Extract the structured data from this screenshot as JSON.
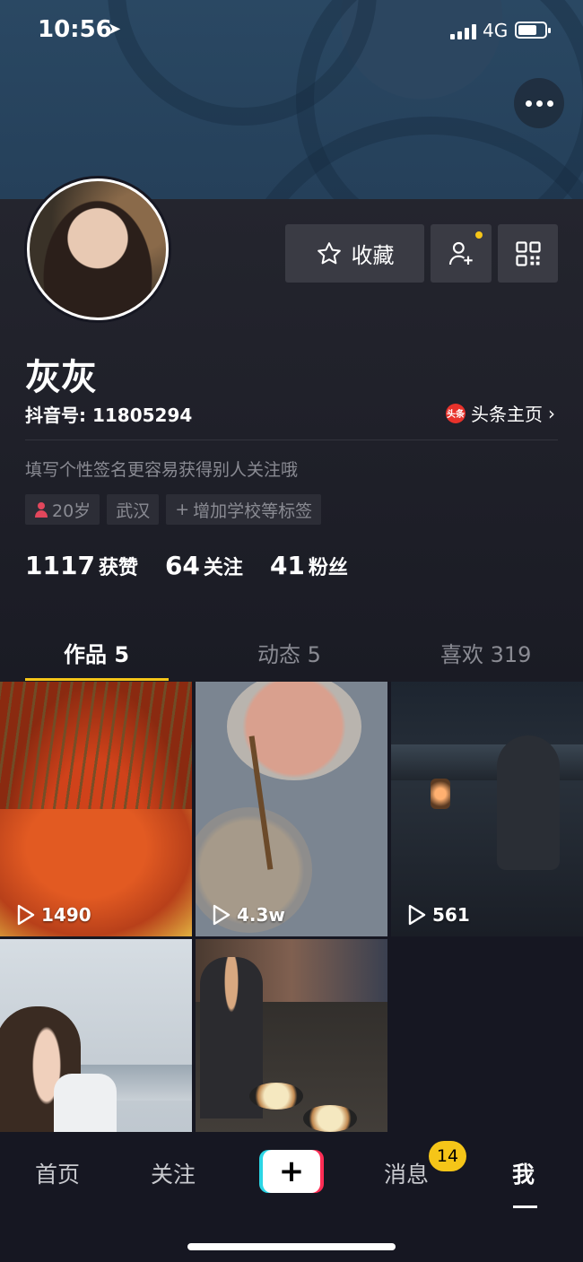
{
  "status_bar": {
    "time": "10:56",
    "network": "4G"
  },
  "profile": {
    "nickname": "灰灰",
    "douyin_id": "抖音号: 11805294",
    "toutiao_link": "头条主页",
    "toutiao_badge": "头条",
    "bio": "填写个性签名更容易获得别人关注哦",
    "tags": [
      "20岁",
      "武汉",
      "增加学校等标签"
    ]
  },
  "actions": {
    "favorite_label": "收藏"
  },
  "stats": [
    {
      "value": "1117",
      "label": "获赞"
    },
    {
      "value": "64",
      "label": "关注"
    },
    {
      "value": "41",
      "label": "粉丝"
    }
  ],
  "tabs": [
    {
      "label": "作品 5"
    },
    {
      "label": "动态 5"
    },
    {
      "label": "喜欢 319"
    }
  ],
  "videos": [
    {
      "plays": "1490"
    },
    {
      "plays": "4.3w"
    },
    {
      "plays": "561"
    },
    {
      "plays": ""
    },
    {
      "plays": ""
    }
  ],
  "bottom_nav": {
    "home": "首页",
    "follow": "关注",
    "messages": "消息",
    "messages_badge": "14",
    "me": "我"
  },
  "colors": {
    "accent": "#f5c518",
    "background": "#161722",
    "plus_cyan": "#2bd6e5",
    "plus_red": "#ff2d55"
  }
}
